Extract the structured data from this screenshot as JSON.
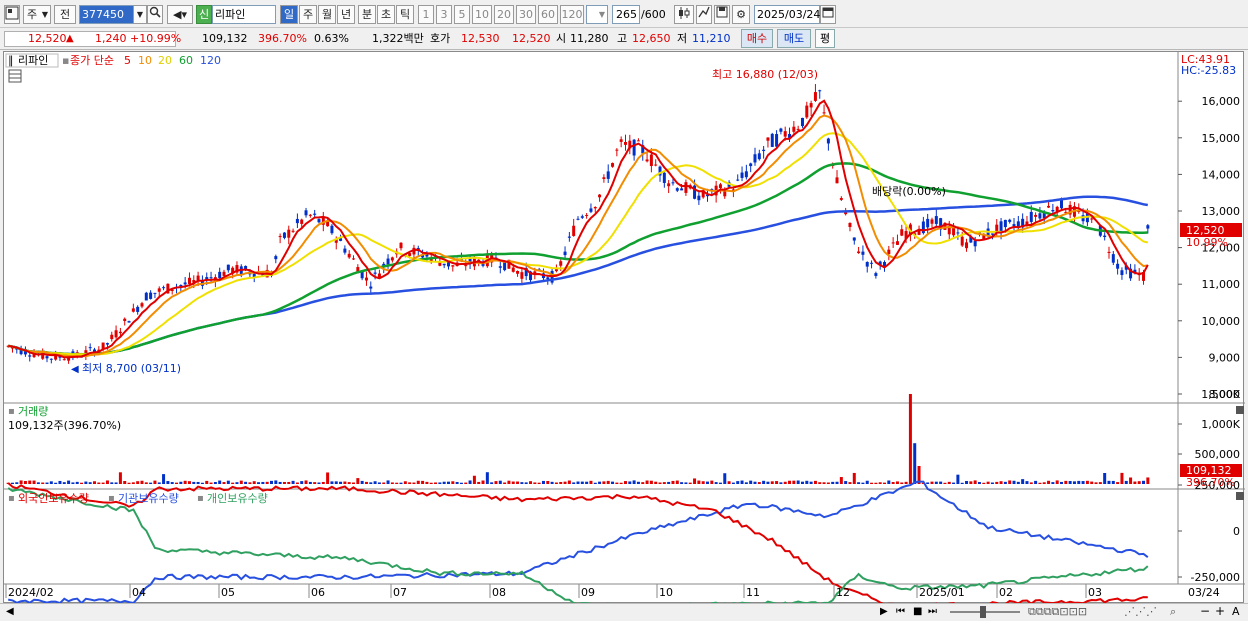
{
  "toolbar": {
    "market": "주",
    "prev": "전",
    "code": "377450",
    "credit": "신",
    "name": "리파인",
    "periods": [
      "일",
      "주",
      "월",
      "년",
      "분",
      "초",
      "틱"
    ],
    "active_period": "일",
    "intervals": [
      "1",
      "3",
      "5",
      "10",
      "20",
      "30",
      "60",
      "120"
    ],
    "count": "265",
    "count_max": "/600",
    "date": "2025/03/24"
  },
  "quote": {
    "price": "12,520",
    "change": "1,240",
    "rate": "+10.99%",
    "volume": "109,132",
    "vol_ratio": "396.70%",
    "turnover": "0.63%",
    "amount": "1,322백만",
    "hoga_label": "호가",
    "ask": "12,530",
    "bid": "12,520",
    "open_label": "시",
    "open": "11,280",
    "high_label": "고",
    "high": "12,650",
    "low_label": "저",
    "low": "11,210",
    "buy": "매수",
    "sell": "매도",
    "eval": "평"
  },
  "price_panel": {
    "name": "리파인",
    "ma_title": "종가 단순",
    "ma_periods": [
      "5",
      "10",
      "20",
      "60",
      "120"
    ],
    "lc": "LC:43.91",
    "hc": "HC:-25.83",
    "high_note": "최고 16,880 (12/03)",
    "low_note": "최저 8,700 (03/11)",
    "dividend_note": "배당락(0.00%)",
    "last_price": "12,520",
    "last_rate": "10.99%",
    "y_ticks": [
      "16,000",
      "15,000",
      "14,000",
      "13,000",
      "12,000",
      "11,000",
      "10,000",
      "9,000",
      "8,000"
    ]
  },
  "volume_panel": {
    "title": "거래량",
    "value": "109,132주(396.70%)",
    "y_ticks": [
      "1,500K",
      "1,000K",
      "500,000"
    ],
    "last_value": "109,132",
    "last_rate": "396.70%"
  },
  "holding_panel": {
    "series": [
      "외국인보유수량",
      "기관보유수량",
      "개인보유수량"
    ],
    "y_ticks": [
      "250,000",
      "0",
      "-250,000"
    ]
  },
  "x_axis": [
    "2024/02",
    "04",
    "05",
    "06",
    "07",
    "08",
    "09",
    "10",
    "11",
    "12",
    "2025/01",
    "02",
    "03",
    "03/24"
  ],
  "colors": {
    "up": "#e00000",
    "down": "#0030c8",
    "ma5": "#e00000",
    "ma10": "#f28c00",
    "ma20": "#f0e000",
    "ma60": "#10a030",
    "ma120": "#2850e0",
    "foreign": "#2850e0",
    "institution": "#e00000",
    "individual": "#30a060"
  },
  "icons": [
    "chart-type-icon",
    "search-icon",
    "speaker-icon",
    "candle-icon",
    "draw-icon",
    "save-icon",
    "gear-icon",
    "calendar-icon",
    "grid-icon"
  ]
}
